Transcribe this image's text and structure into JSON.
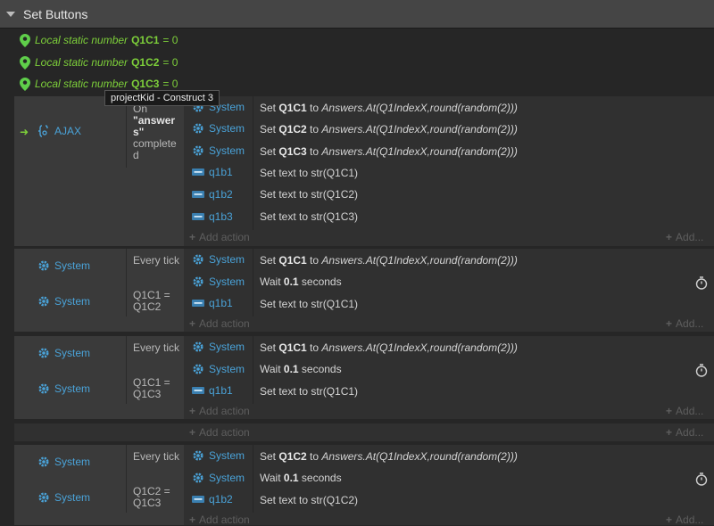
{
  "group": {
    "title": "Set Buttons"
  },
  "variables": [
    {
      "prefix": "Local static number",
      "name": "Q1C1",
      "value": "= 0"
    },
    {
      "prefix": "Local static number",
      "name": "Q1C2",
      "value": "= 0"
    },
    {
      "prefix": "Local static number",
      "name": "Q1C3",
      "value": "= 0"
    }
  ],
  "tooltip": "projectKid - Construct 3",
  "events": [
    {
      "cond_obj": "AJAX",
      "cond_text": [
        "On",
        "\"answer",
        "s\"",
        "complete",
        "d"
      ],
      "actions": [
        {
          "obj": "System",
          "p1": "Set ",
          "b1": "Q1C1",
          "p2": " to ",
          "i1": "Answers.At(Q1IndexX,round(random(2)))"
        },
        {
          "obj": "System",
          "p1": "Set ",
          "b1": "Q1C2",
          "p2": " to ",
          "i1": "Answers.At(Q1IndexX,round(random(2)))"
        },
        {
          "obj": "System",
          "p1": "Set ",
          "b1": "Q1C3",
          "p2": " to ",
          "i1": "Answers.At(Q1IndexX,round(random(2)))"
        },
        {
          "obj": "q1b1",
          "p1": "Set text to str(Q1C1)"
        },
        {
          "obj": "q1b2",
          "p1": "Set text to str(Q1C2)"
        },
        {
          "obj": "q1b3",
          "p1": "Set text to str(Q1C3)"
        }
      ]
    },
    {
      "conds": [
        {
          "obj": "System",
          "text": "Every tick"
        },
        {
          "obj": "System",
          "text": "Q1C1 = Q1C2"
        }
      ],
      "actions": [
        {
          "obj": "System",
          "p1": "Set ",
          "b1": "Q1C1",
          "p2": " to ",
          "i1": "Answers.At(Q1IndexX,round(random(2)))"
        },
        {
          "obj": "System",
          "p1": "Wait ",
          "b1": "0.1",
          "p2": " seconds"
        },
        {
          "obj": "q1b1",
          "p1": "Set text to str(Q1C1)"
        }
      ]
    },
    {
      "conds": [
        {
          "obj": "System",
          "text": "Every tick"
        },
        {
          "obj": "System",
          "text": "Q1C1 = Q1C3"
        }
      ],
      "actions": [
        {
          "obj": "System",
          "p1": "Set ",
          "b1": "Q1C1",
          "p2": " to ",
          "i1": "Answers.At(Q1IndexX,round(random(2)))"
        },
        {
          "obj": "System",
          "p1": "Wait ",
          "b1": "0.1",
          "p2": " seconds"
        },
        {
          "obj": "q1b1",
          "p1": "Set text to str(Q1C1)"
        }
      ]
    },
    {
      "conds": [
        {
          "obj": "System",
          "text": "Every tick"
        },
        {
          "obj": "System",
          "text": "Q1C2 = Q1C3"
        }
      ],
      "actions": [
        {
          "obj": "System",
          "p1": "Set ",
          "b1": "Q1C2",
          "p2": " to ",
          "i1": "Answers.At(Q1IndexX,round(random(2)))"
        },
        {
          "obj": "System",
          "p1": "Wait ",
          "b1": "0.1",
          "p2": " seconds"
        },
        {
          "obj": "q1b2",
          "p1": "Set text to str(Q1C2)"
        }
      ]
    }
  ],
  "labels": {
    "add_action": "Add action",
    "add_short": "Add...",
    "plus": "+",
    "arrow": "➜"
  },
  "colors": {
    "object": "#4aa3d9",
    "variable": "#7dcf3a",
    "background": "#262626"
  }
}
